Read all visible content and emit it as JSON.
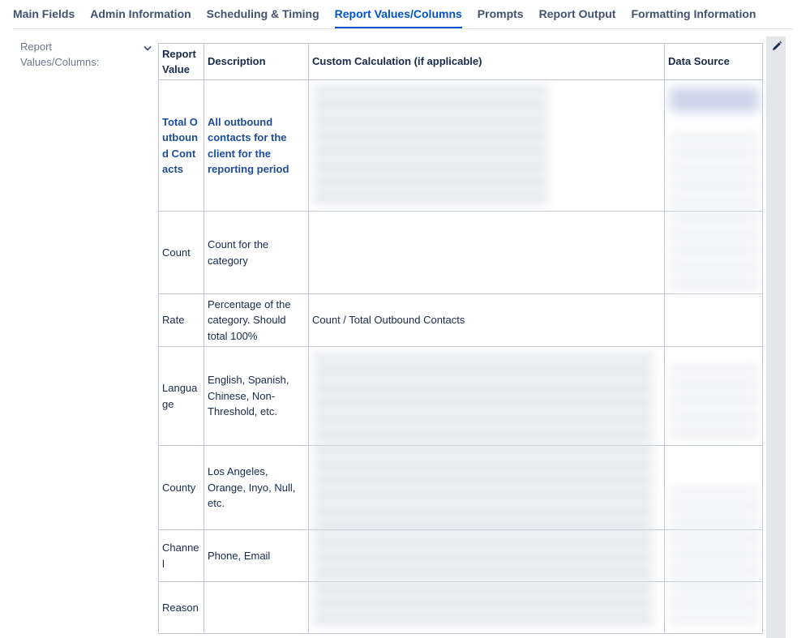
{
  "tabs": [
    {
      "label": "Main Fields"
    },
    {
      "label": "Admin Information"
    },
    {
      "label": "Scheduling & Timing"
    },
    {
      "label": "Report Values/Columns"
    },
    {
      "label": "Prompts"
    },
    {
      "label": "Report Output"
    },
    {
      "label": "Formatting Information"
    }
  ],
  "active_tab": "Report Values/Columns",
  "field": {
    "label": "Report Values/Columns:"
  },
  "icons": {
    "collapse": "chevron-down-icon",
    "edit": "pencil-icon"
  },
  "table": {
    "headers": {
      "report_value": "Report Value",
      "description": "Description",
      "custom_calculation": "Custom Calculation (if applicable)",
      "data_source": "Data Source"
    },
    "rows": [
      {
        "report_value": "Total Outbound Contacts",
        "description": "All outbound contacts for the client for the reporting period",
        "custom_calculation": "",
        "data_source": ""
      },
      {
        "report_value": "Count",
        "description": "Count for the category",
        "custom_calculation": "",
        "data_source": ""
      },
      {
        "report_value": "Rate",
        "description": "Percentage of the category. Should total 100%",
        "custom_calculation": "Count / Total Outbound Contacts",
        "data_source": ""
      },
      {
        "report_value": "Language",
        "description": "English, Spanish, Chinese, Non-Threshold, etc.",
        "custom_calculation": "",
        "data_source": ""
      },
      {
        "report_value": "County",
        "description": "Los Angeles, Orange, Inyo, Null, etc.",
        "custom_calculation": "",
        "data_source": ""
      },
      {
        "report_value": "Channel",
        "description": "Phone, Email",
        "custom_calculation": "",
        "data_source": ""
      },
      {
        "report_value": "Reason",
        "description": "",
        "custom_calculation": "",
        "data_source": ""
      }
    ]
  },
  "colors": {
    "accent": "#0052cc",
    "first_row_text": "#1c4c9c",
    "text": "#172b4d",
    "muted": "#6b778c"
  }
}
